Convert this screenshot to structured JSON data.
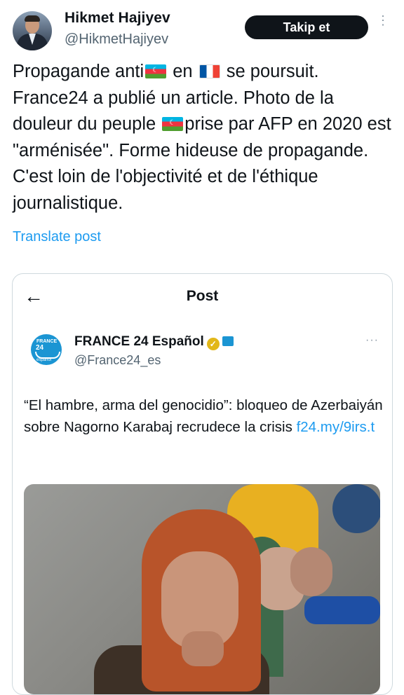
{
  "tweet": {
    "author_name": "Hikmet Hajiyev",
    "author_handle": "@HikmetHajiyev",
    "follow_label": "Takip et",
    "more_glyph": "⋮",
    "text_parts": [
      "Propagande anti",
      " en ",
      " se poursuit. France24 a publié un article. Photo de la douleur du peuple ",
      "prise par AFP en 2020 est \"arménisée\". Forme hideuse de propagande. C'est loin de l'objectivité et de l'éthique journalistique."
    ],
    "flags": [
      "azerbaijan-flag",
      "france-flag",
      "azerbaijan-flag"
    ],
    "translate_label": "Translate post"
  },
  "quoted": {
    "header_title": "Post",
    "back_glyph": "←",
    "account_name": "FRANCE 24 Español",
    "account_handle": "@France24_es",
    "logo_top": "FRANCE",
    "logo_num": "24",
    "logo_bottom": "español",
    "more_glyph": "···",
    "headline": "“El hambre, arma del genocidio”: bloqueo de Azerbaiyán sobre Nagorno Karabaj recrudece la crisis ",
    "link": "f24.my/9irs.t"
  },
  "colors": {
    "link_blue": "#1d9bf0",
    "follow_bg": "#0f1419",
    "secondary_text": "#536471",
    "border": "#cfd9de"
  }
}
